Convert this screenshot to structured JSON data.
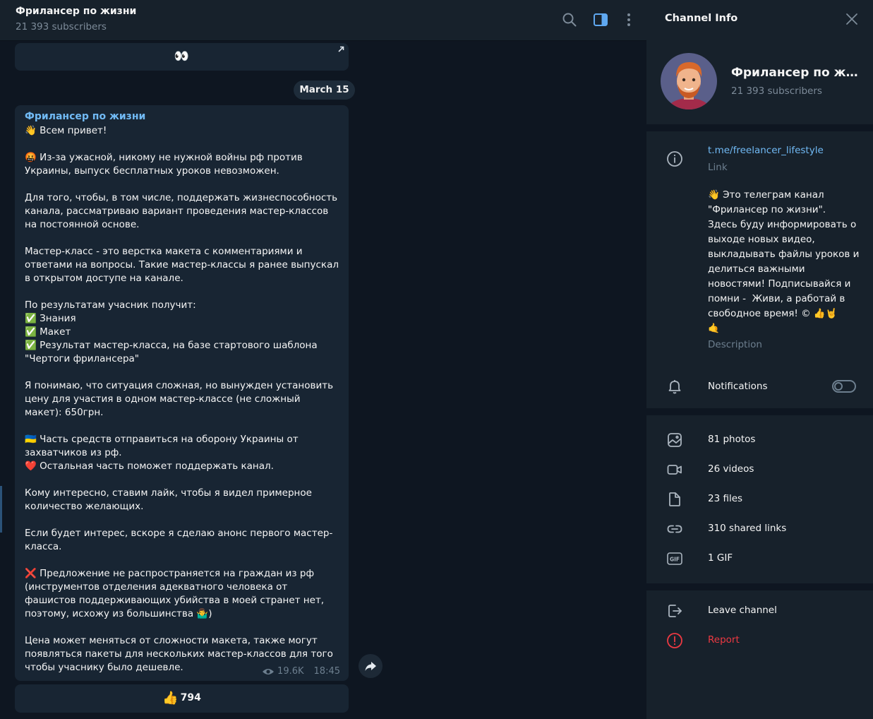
{
  "chat": {
    "title": "Фрилансер по жизни",
    "subtitle": "21 393 subscribers",
    "top_bubble_emoji": "👀",
    "date_label": "March 15",
    "message": {
      "author": "Фрилансер по жизни",
      "text": "👋 Всем привет!\n\n🤬 Из-за ужасной, никому не нужной войны рф против Украины, выпуск бесплатных уроков невозможен.\n\nДля того, чтобы, в том числе, поддержать жизнеспособность канала, рассматриваю вариант проведения мастер-классов на постоянной основе.\n\nМастер-класс - это верстка макета с комментариями и ответами на вопросы. Такие мастер-классы я ранее выпускал в открытом доступе на канале.\n\nПо результатам учасник получит:\n✅ Знания\n✅ Макет\n✅ Результат мастер-класса, на базе стартового шаблона \"Чертоги фрилансера\"\n\nЯ понимаю, что ситуация сложная, но вынужден установить цену для участия в одном мастер-классе (не сложный макет): 650грн.\n\n🇺🇦 Часть средств отправиться на оборону Украины от захватчиков из рф.\n❤️ Остальная часть поможет поддержать канал.\n\nКому интересно, ставим лайк, чтобы я видел примерное количество желающих.\n\nЕсли будет интерес, вскоре я сделаю анонс первого мастер-класса.\n\n❌ Предложение не распространяется на граждан из рф (инструментов отделения адекватного человека от фашистов поддерживающих убийства в моей странет нет, поэтому, исхожу из большинства 🤷‍♂️)\n\nЦена может меняться от сложности макета, также могут появляться пакеты для нескольких мастер-классов для того чтобы учаснику было дешевле.",
      "views": "19.6K",
      "time": "18:45"
    },
    "reaction": {
      "emoji": "👍",
      "count": "794"
    }
  },
  "panel": {
    "title": "Channel Info",
    "channel_name": "Фрилансер по жизни",
    "subscribers": "21 393 subscribers",
    "link": "t.me/freelancer_lifestyle",
    "link_label": "Link",
    "description": "👋 Это телеграм канал \"Фрилансер по жизни\".\nЗдесь буду информировать о выходе новых видео, выкладывать файлы уроков и делиться важными новостями! Подписывайся и помни -  Живи, а работай в свободное время! © 👍🤘\n🤙",
    "description_label": "Description",
    "notifications_label": "Notifications",
    "notifications_on": false,
    "media": {
      "photos": "81 photos",
      "videos": "26 videos",
      "files": "23 files",
      "links": "310 shared links",
      "gifs": "1 GIF"
    },
    "leave_label": "Leave channel",
    "report_label": "Report"
  },
  "colors": {
    "background": "#0e1621",
    "panel": "#17212b",
    "bubble": "#182533",
    "accent_link": "#71baf5",
    "danger": "#ec3942"
  }
}
